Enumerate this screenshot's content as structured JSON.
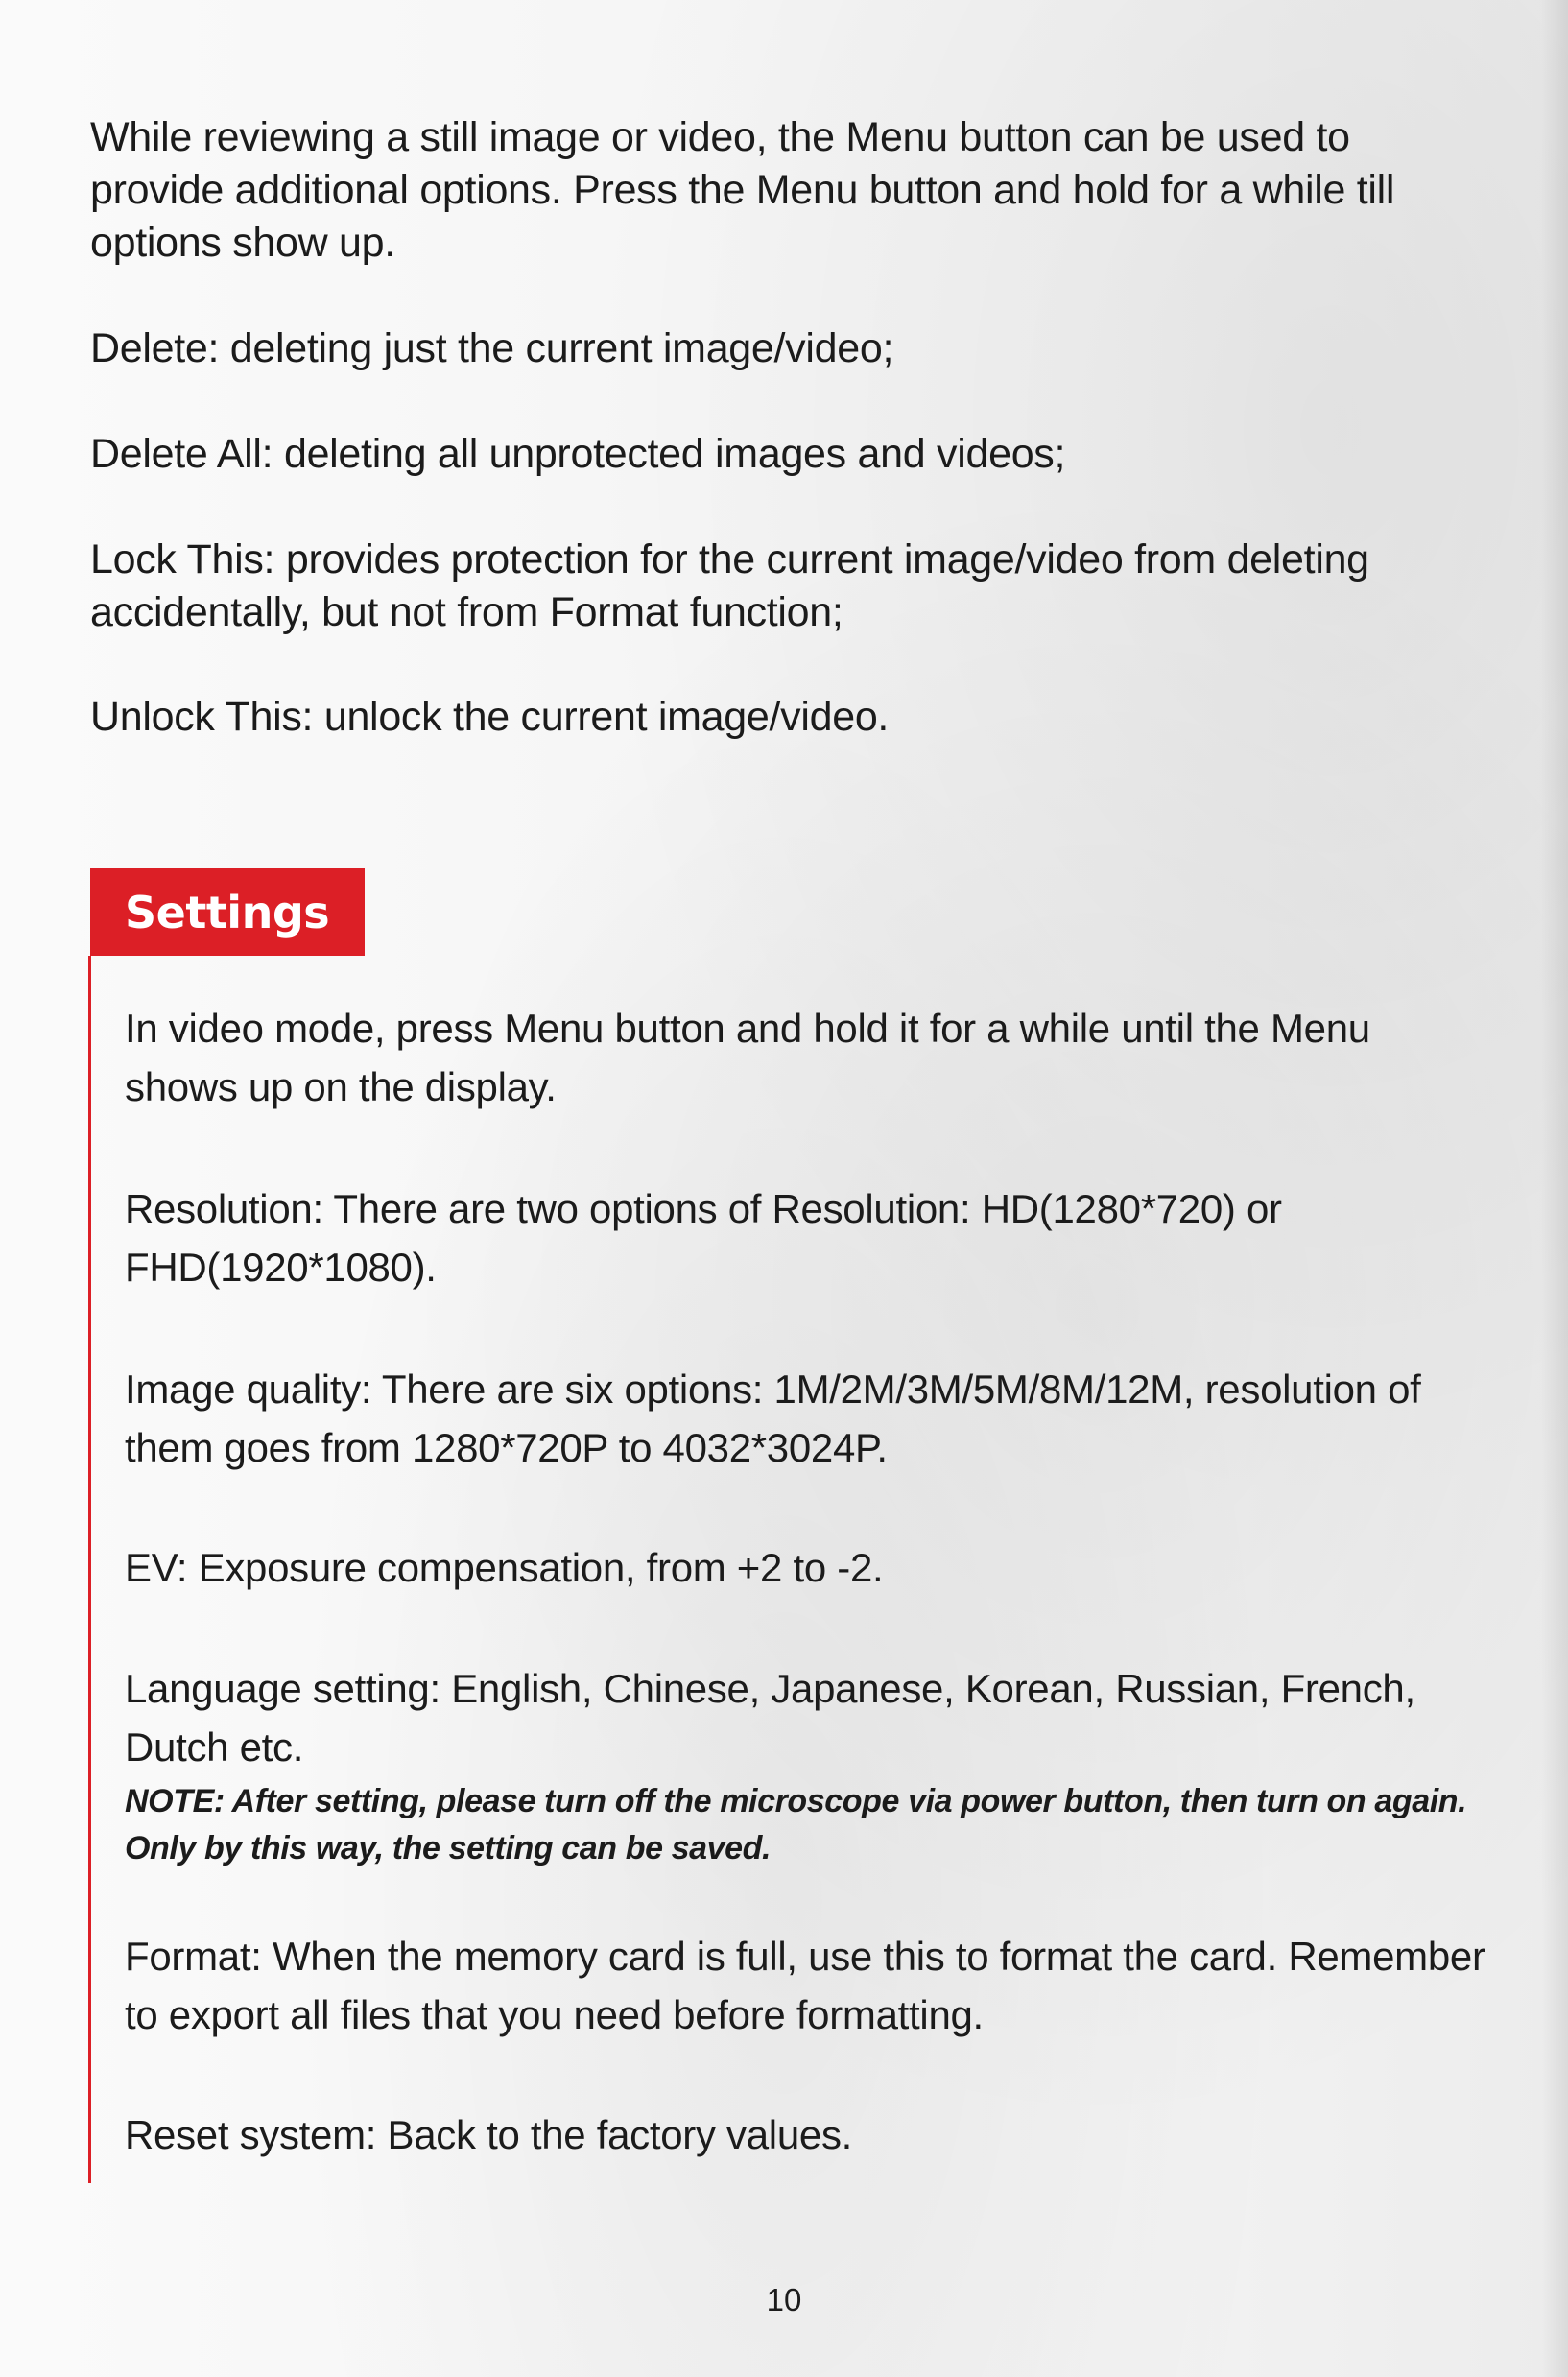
{
  "review": {
    "intro": "While reviewing a still image or video, the Menu button can be used to provide additional options. Press the Menu button and hold for a while till options show up.",
    "delete": "Delete: deleting just the current image/video;",
    "delete_all": "Delete All: deleting all unprotected images and videos;",
    "lock_this": "Lock This: provides protection for the current image/video from deleting accidentally, but not from Format function;",
    "unlock_this": "Unlock This: unlock the current image/video."
  },
  "settings": {
    "heading": "Settings",
    "intro": "In video mode, press Menu button and hold it for a while until the Menu shows up on the display.",
    "resolution": "Resolution: There are two options of Resolution: HD(1280*720) or FHD(1920*1080).",
    "image_quality": "Image quality: There are six options: 1M/2M/3M/5M/8M/12M, resolution of them goes from 1280*720P to 4032*3024P.",
    "ev": "EV: Exposure compensation, from +2 to -2.",
    "language": "Language setting: English, Chinese, Japanese, Korean, Russian, French, Dutch etc.",
    "note": "NOTE: After setting, please turn off the microscope via power button, then turn on again. Only by this way, the setting can be saved.",
    "format": "Format: When the memory card is full, use this to format the card. Remember to export all files that you need before formatting.",
    "reset": "Reset system: Back to the factory values.",
    "accent_color": "#dc1f26"
  },
  "page_number": "10"
}
